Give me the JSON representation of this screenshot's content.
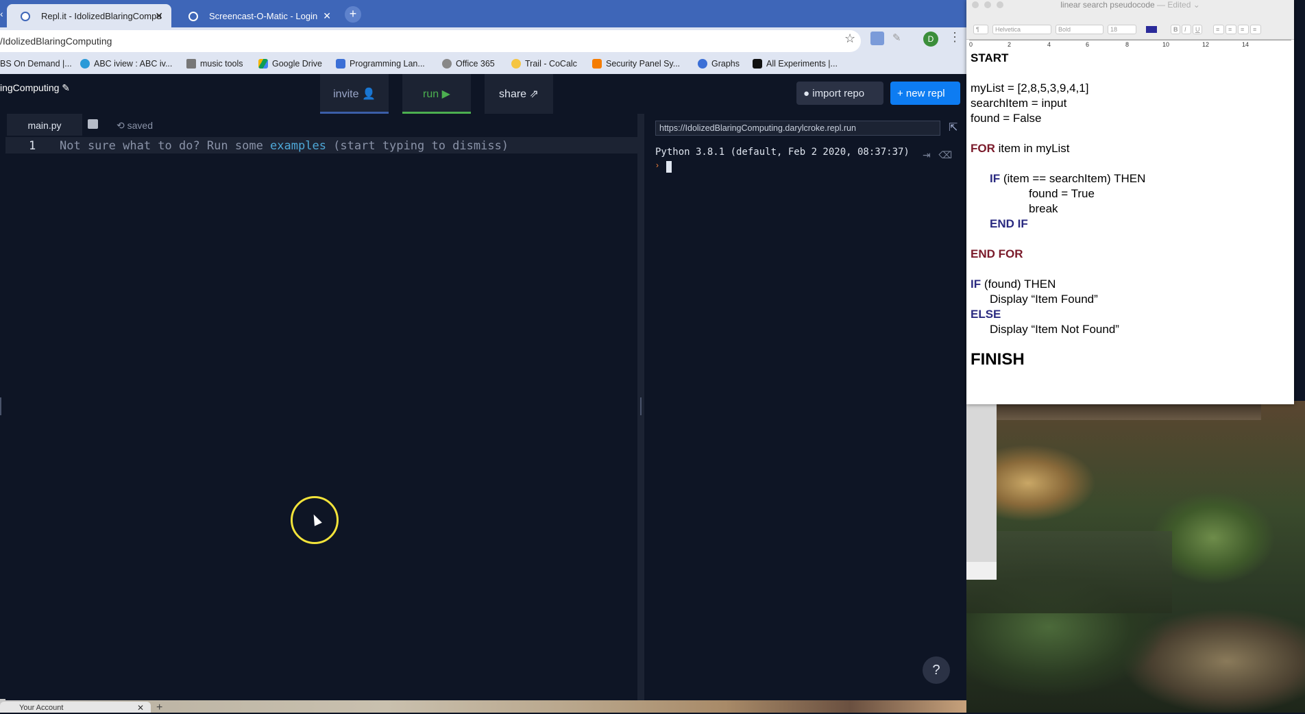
{
  "browser": {
    "tabs": [
      {
        "label": "Repl.it - IdolizedBlaringCompu"
      },
      {
        "label": "Screencast-O-Matic - Login"
      }
    ],
    "address": "/IdolizedBlaringComputing",
    "profile_initial": "D",
    "bookmarks": [
      {
        "label": "BS On Demand |..."
      },
      {
        "label": "ABC iview : ABC iv..."
      },
      {
        "label": "music tools"
      },
      {
        "label": "Google Drive"
      },
      {
        "label": "Programming Lan..."
      },
      {
        "label": "Office 365"
      },
      {
        "label": "Trail - CoCalc"
      },
      {
        "label": "Security Panel Sy..."
      },
      {
        "label": "Graphs"
      },
      {
        "label": "All Experiments |..."
      }
    ],
    "bottom_tab": "Your Account"
  },
  "repl": {
    "name": "ingComputing",
    "invite": "invite",
    "run": "run",
    "share": "share",
    "import_repo": "import repo",
    "new_repl": "+ new repl",
    "file_tab": "main.py",
    "saved": "saved",
    "line_number": "1",
    "hint_pre": "Not sure what to do? Run some ",
    "hint_link": "examples",
    "hint_post": " (start typing to dismiss)",
    "url": "https://IdolizedBlaringComputing.darylcroke.repl.run",
    "python_version": "Python 3.8.1 (default, Feb  2 2020, 08:37:37)",
    "help": "?"
  },
  "textedit": {
    "title": "linear search pseudocode",
    "edited": "— Edited ⌄",
    "toolbar": {
      "font": "Helvetica",
      "weight": "Bold",
      "size": "18"
    },
    "ruler": [
      "0",
      "2",
      "4",
      "6",
      "8",
      "10",
      "12",
      "14"
    ],
    "lines": {
      "start": "START",
      "mylist": "myList = [2,8,5,3,9,4,1]",
      "searchitem": "searchItem = input",
      "found": "found = False",
      "for_kw": "FOR",
      "for_rest": " item in myList",
      "if_kw": "IF",
      "if_rest": " (item == searchItem) THEN",
      "found_true": "found = True",
      "break": "break",
      "endif": "END IF",
      "endfor": "END FOR",
      "if2_kw": "IF",
      "if2_rest": " (found) THEN",
      "display1": "Display “Item Found”",
      "else": "ELSE",
      "display2": "Display “Item Not Found”",
      "finish": "FINISH"
    }
  },
  "colors": {
    "accent": "#0d7cf2",
    "run_green": "#4caf50",
    "keyword_red": "#7a1a2a",
    "keyword_blue": "#2a2a80"
  }
}
